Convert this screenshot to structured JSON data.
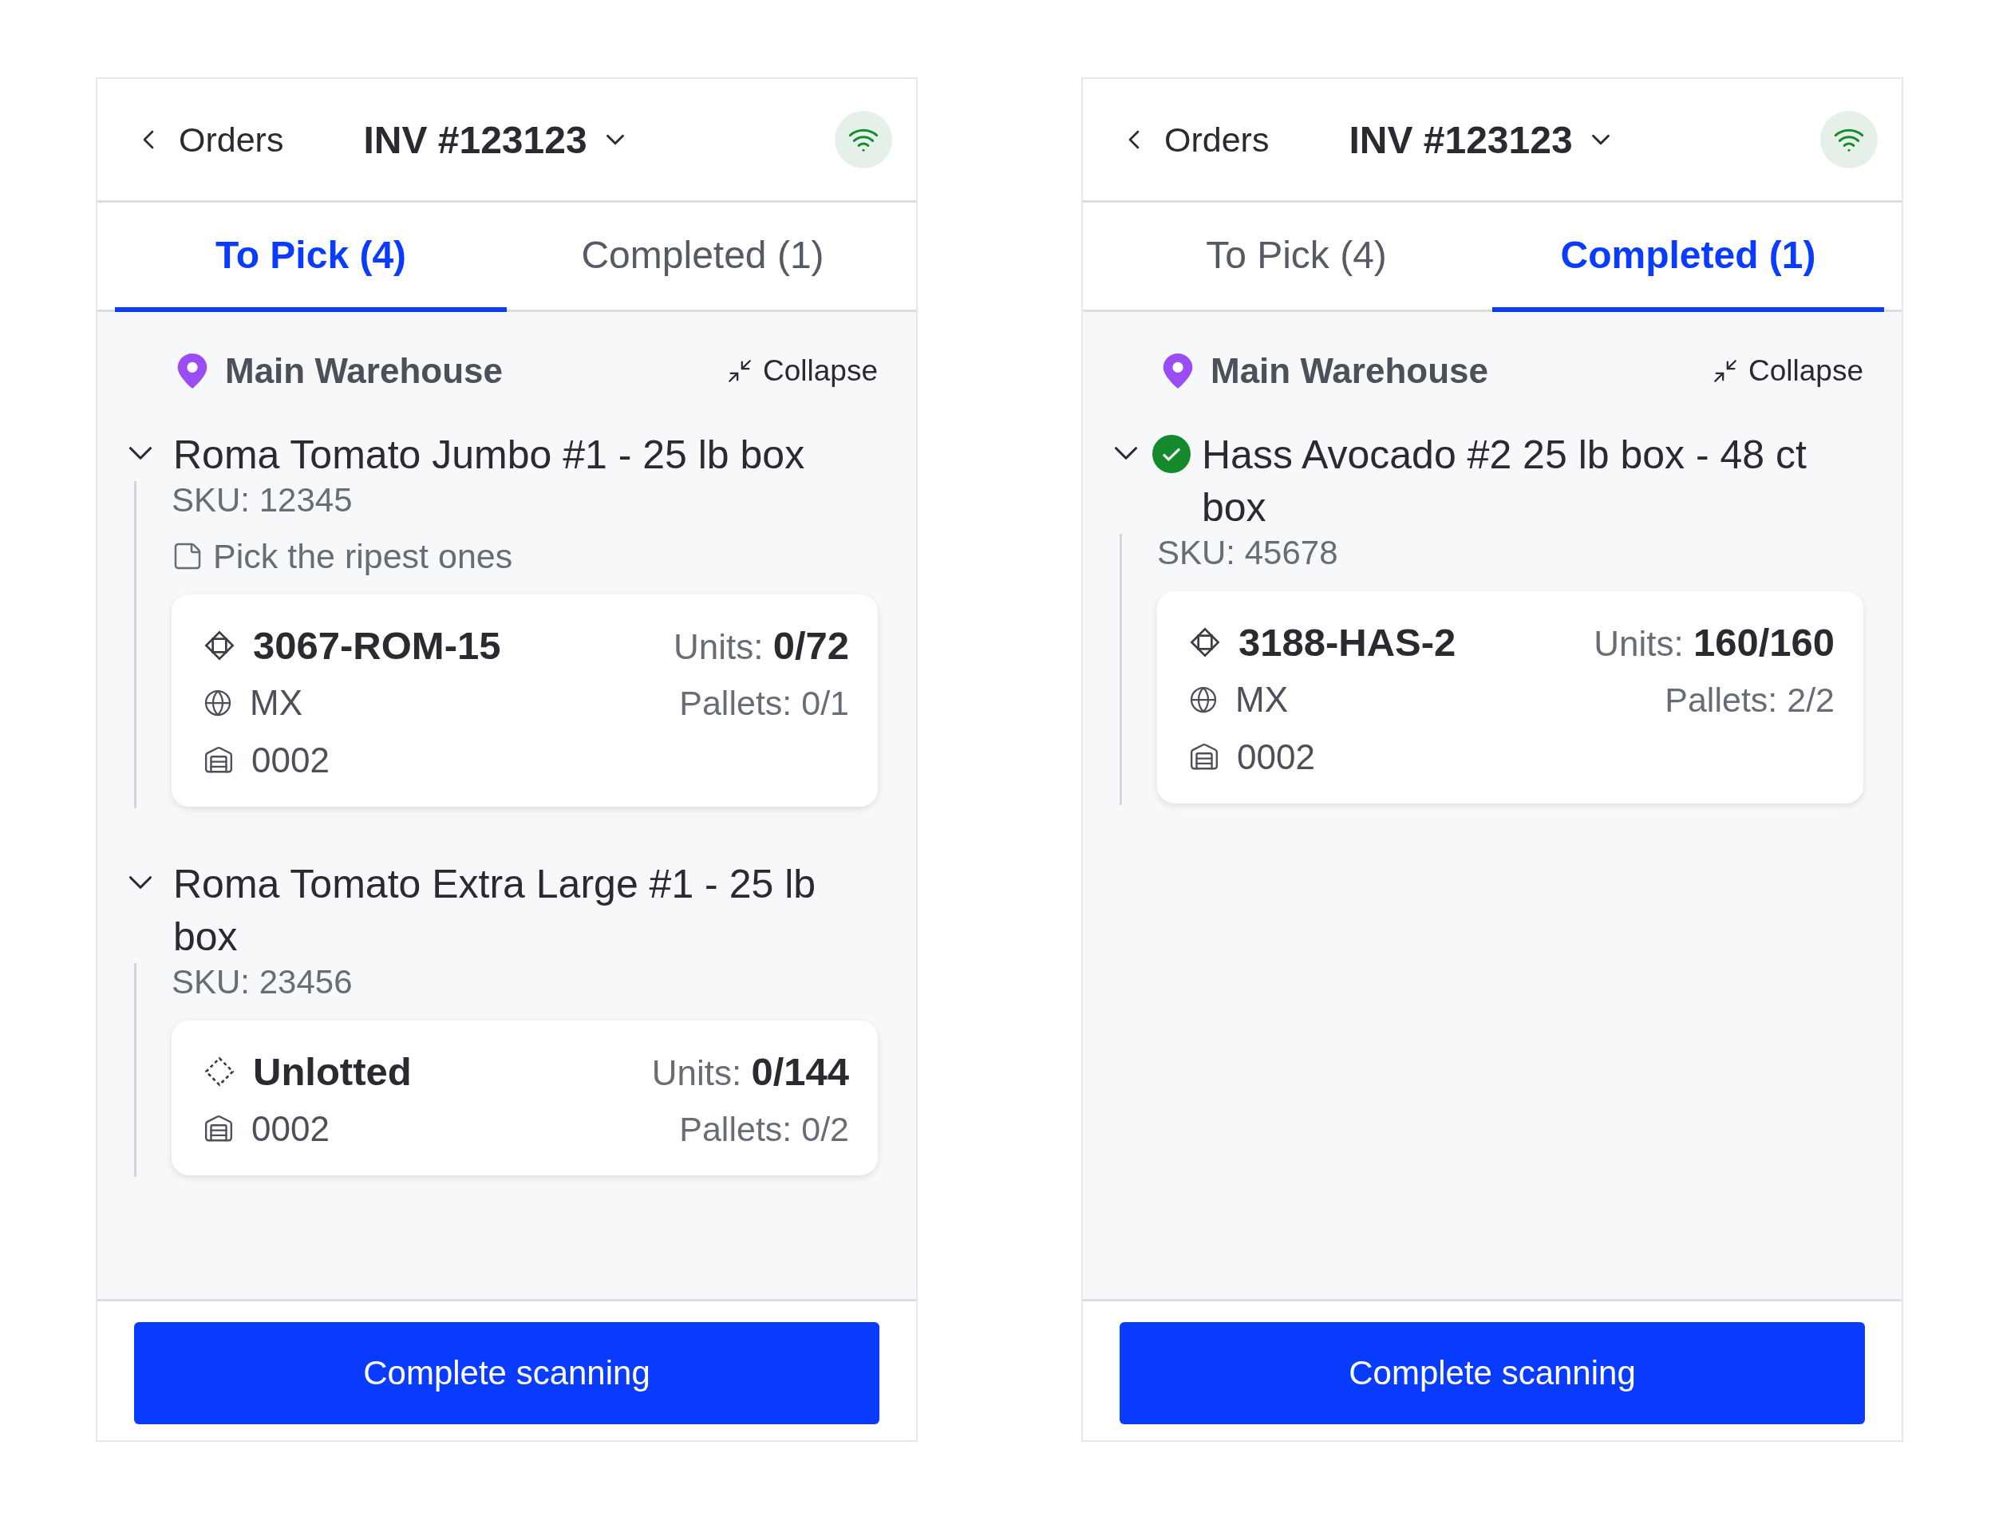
{
  "screens": [
    {
      "header": {
        "back_label": "Orders",
        "title": "INV #123123",
        "connected": true
      },
      "tabs": [
        {
          "label": "To Pick (4)",
          "selected": true
        },
        {
          "label": "Completed (1)",
          "selected": false
        }
      ],
      "location": {
        "name": "Main Warehouse",
        "action": "Collapse"
      },
      "items": [
        {
          "title": "Roma Tomato Jumbo #1 - 25 lb box",
          "expanded": true,
          "completed": false,
          "sku": "SKU: 12345",
          "note": "Pick the ripest ones",
          "lots": [
            {
              "kind": "lot",
              "lot": "3067-ROM-15",
              "units_label": "Units:",
              "units": "0/72",
              "origin": "MX",
              "pallets": "Pallets: 0/1",
              "location": "0002"
            }
          ]
        },
        {
          "title": "Roma Tomato Extra Large #1 - 25 lb box",
          "expanded": true,
          "completed": false,
          "sku": "SKU: 23456",
          "lots": [
            {
              "kind": "unlotted",
              "lot": "Unlotted",
              "units_label": "Units:",
              "units": "0/144",
              "pallets": "Pallets: 0/2",
              "location": "0002"
            }
          ]
        }
      ],
      "footer_button": "Complete scanning"
    },
    {
      "header": {
        "back_label": "Orders",
        "title": "INV #123123",
        "connected": true
      },
      "tabs": [
        {
          "label": "To Pick (4)",
          "selected": false
        },
        {
          "label": "Completed (1)",
          "selected": true
        }
      ],
      "location": {
        "name": "Main Warehouse",
        "action": "Collapse"
      },
      "items": [
        {
          "title": "Hass Avocado #2 25 lb box - 48 ct box",
          "expanded": true,
          "completed": true,
          "sku": "SKU: 45678",
          "lots": [
            {
              "kind": "lot",
              "lot": "3188-HAS-2",
              "units_label": "Units:",
              "units": "160/160",
              "origin": "MX",
              "pallets": "Pallets: 2/2",
              "location": "0002"
            }
          ]
        }
      ],
      "footer_button": "Complete scanning"
    }
  ]
}
